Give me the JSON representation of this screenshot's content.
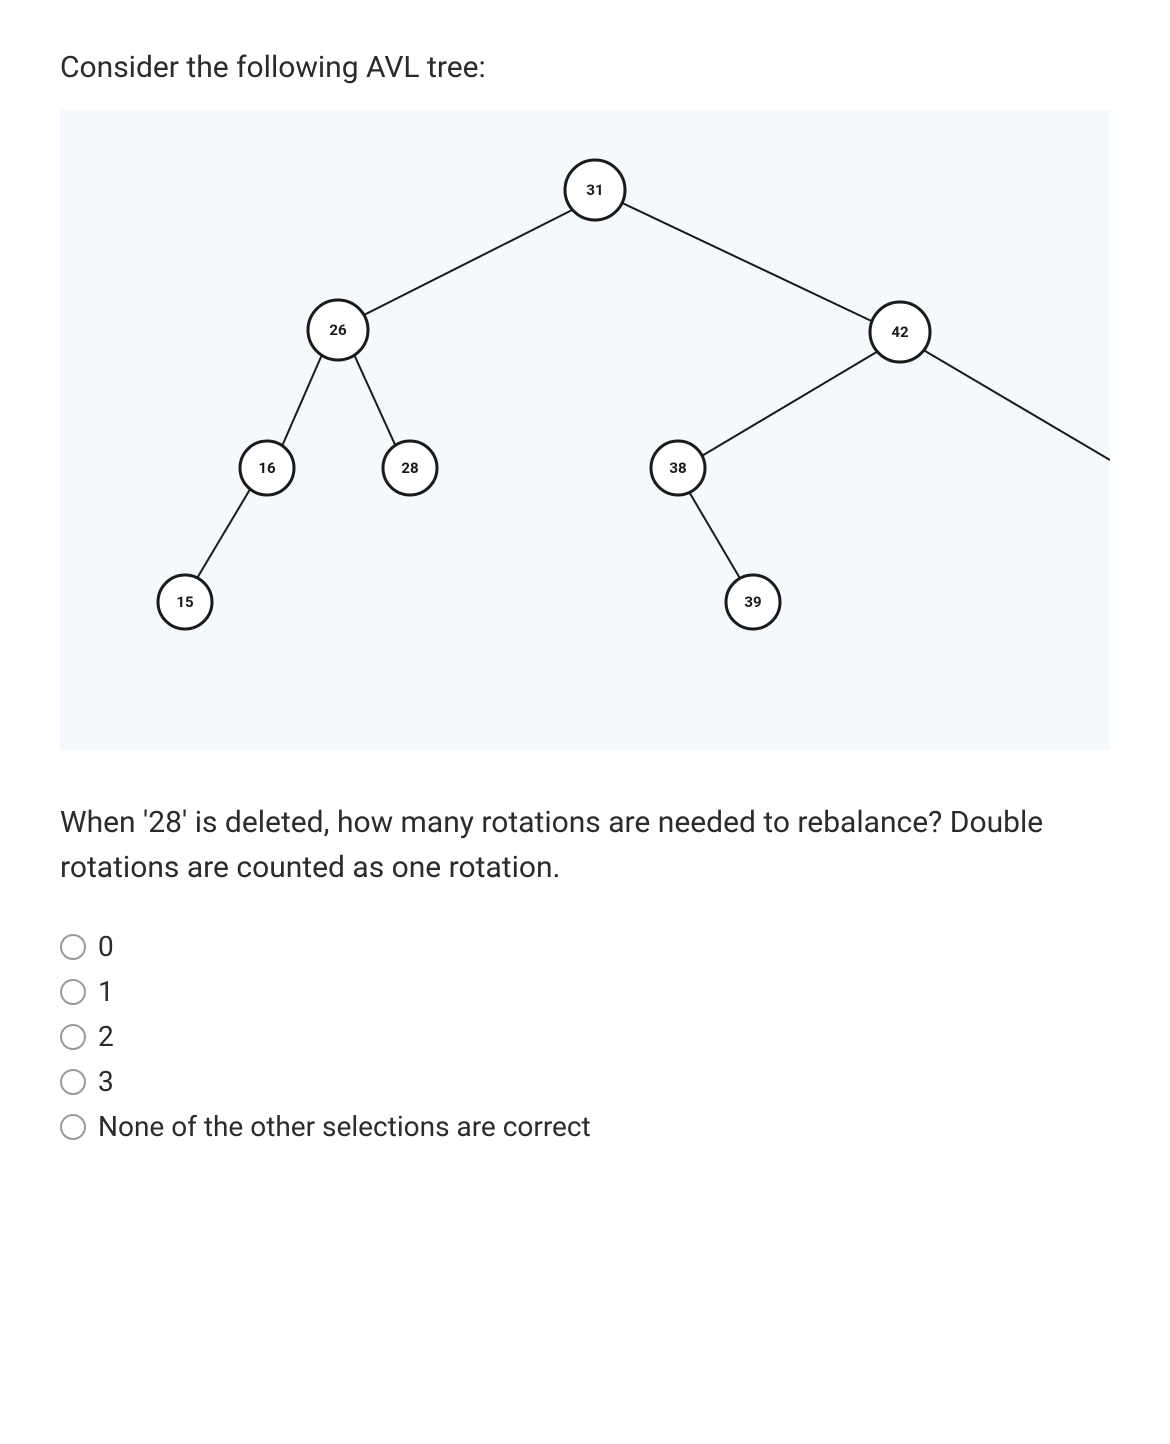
{
  "question": {
    "heading": "Consider the following AVL tree:",
    "prompt": "When '28' is deleted, how many rotations are needed to rebalance? Double rotations are counted as one rotation."
  },
  "tree": {
    "nodes": {
      "n31": "31",
      "n26": "26",
      "n42": "42",
      "n16": "16",
      "n28": "28",
      "n38": "38",
      "n15": "15",
      "n39": "39"
    }
  },
  "options": [
    {
      "label": "0"
    },
    {
      "label": "1"
    },
    {
      "label": "2"
    },
    {
      "label": "3"
    },
    {
      "label": "None of the other selections are correct"
    }
  ]
}
